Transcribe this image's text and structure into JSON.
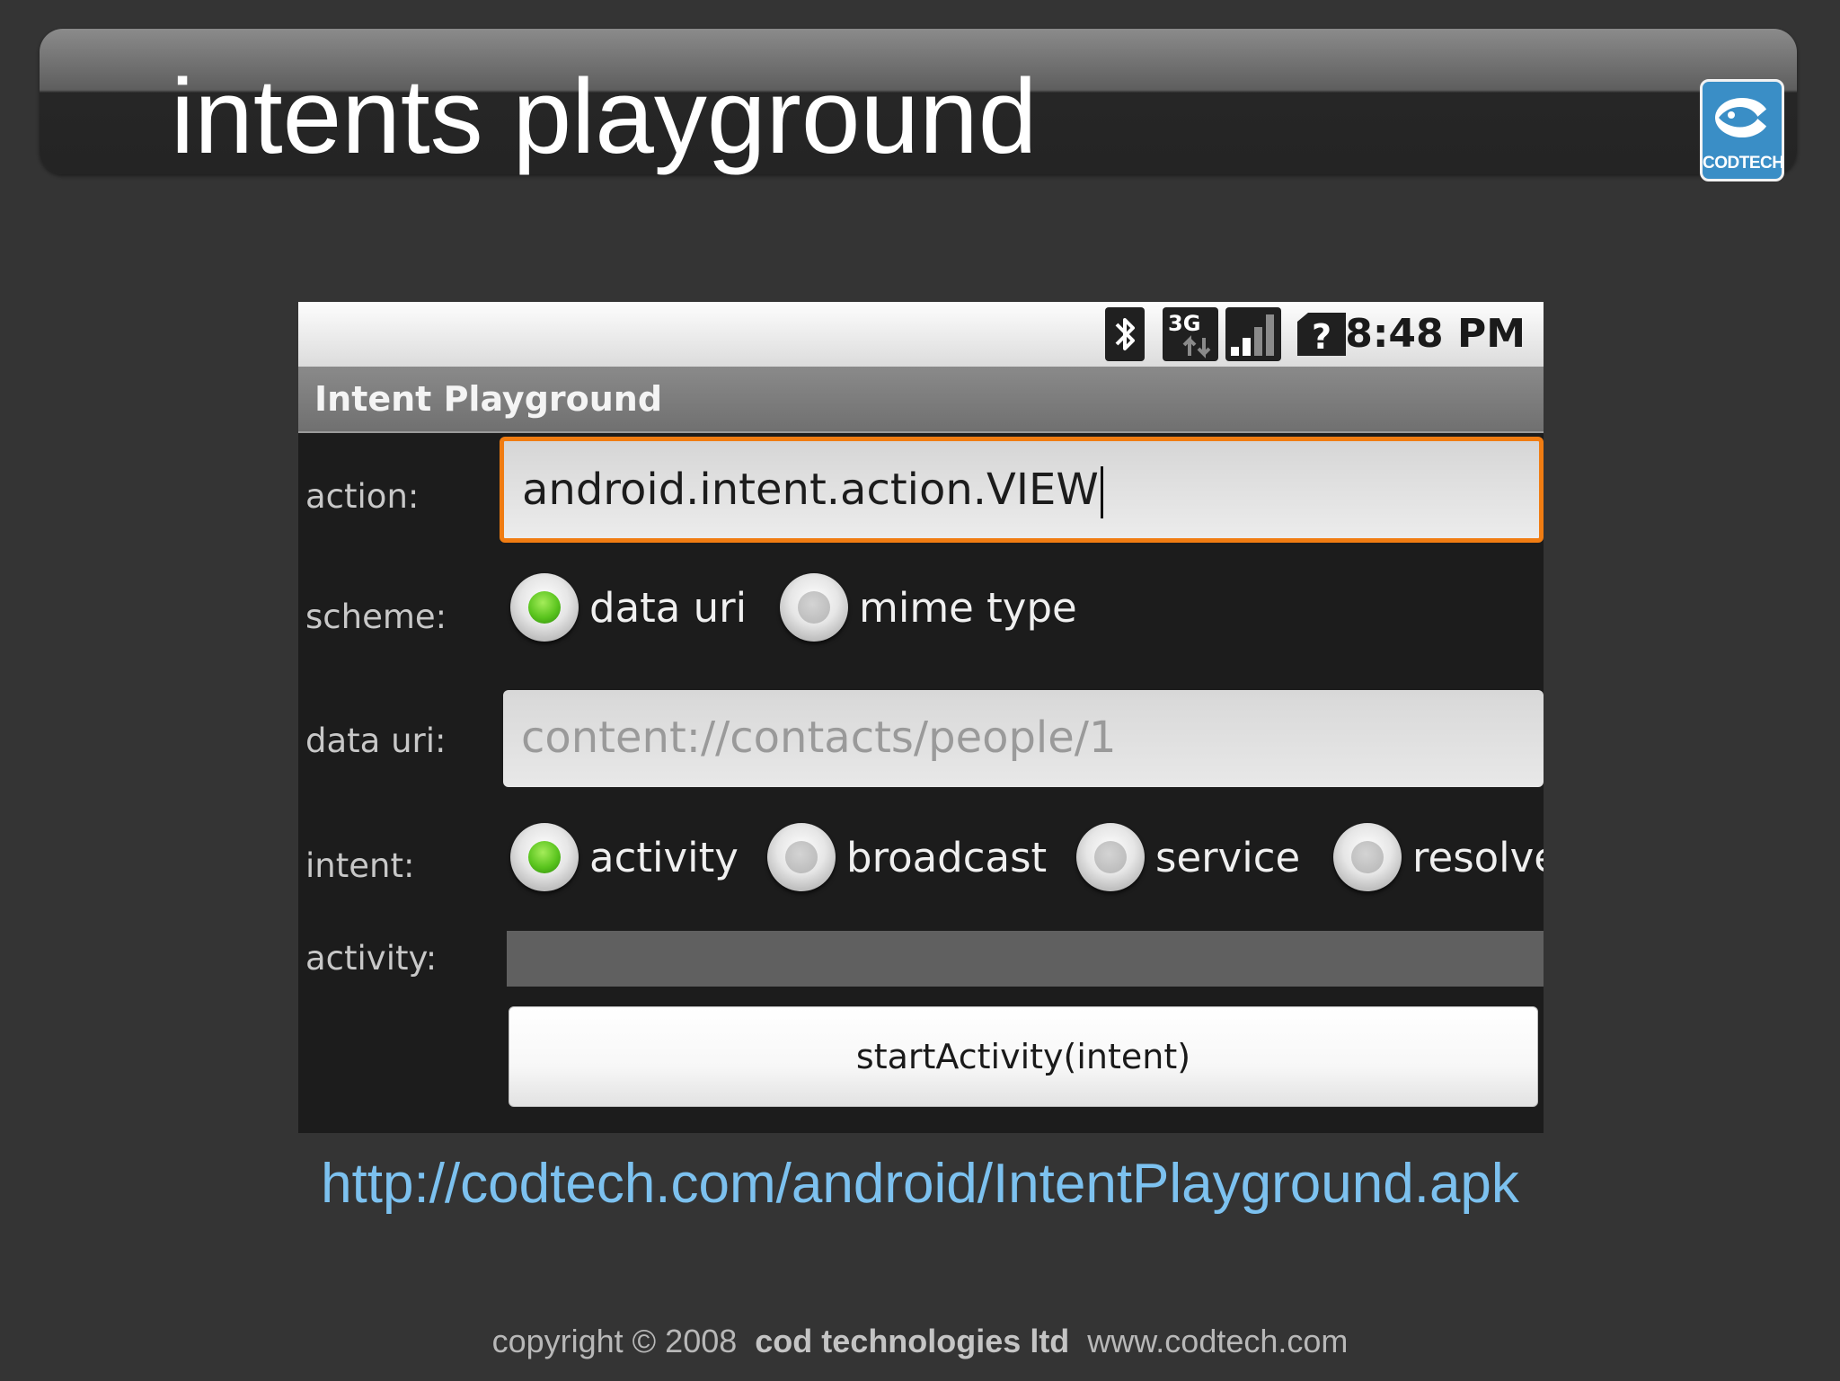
{
  "slide": {
    "title": "intents playground",
    "logo_text": "CODTECH",
    "link": "http://codtech.com/android/IntentPlayground.apk",
    "copyright": "copyright © 2008",
    "company": "cod technologies ltd",
    "website": "www.codtech.com"
  },
  "phone": {
    "status_bar": {
      "time": "8:48 PM",
      "icons": [
        "bluetooth-icon",
        "3g-data-icon",
        "signal-strength-icon",
        "no-sim-icon"
      ],
      "network_label": "3G",
      "sim_label": "?"
    },
    "app_title": "Intent Playground",
    "action": {
      "label": "action:",
      "value": "android.intent.action.VIEW"
    },
    "scheme": {
      "label": "scheme:",
      "options": [
        {
          "label": "data uri",
          "checked": true
        },
        {
          "label": "mime type",
          "checked": false
        }
      ]
    },
    "data_uri": {
      "label": "data uri:",
      "placeholder": "content://contacts/people/1"
    },
    "intent": {
      "label": "intent:",
      "options": [
        {
          "label": "activity",
          "checked": true
        },
        {
          "label": "broadcast",
          "checked": false
        },
        {
          "label": "service",
          "checked": false
        },
        {
          "label": "resolve",
          "checked": false
        }
      ]
    },
    "activity": {
      "label": "activity:",
      "value": ""
    },
    "start_button": "startActivity(intent)"
  },
  "colors": {
    "focus_border": "#f07c12",
    "radio_checked": "#5ac41e",
    "link": "#7cc1ef",
    "slide_background": "#343434"
  }
}
